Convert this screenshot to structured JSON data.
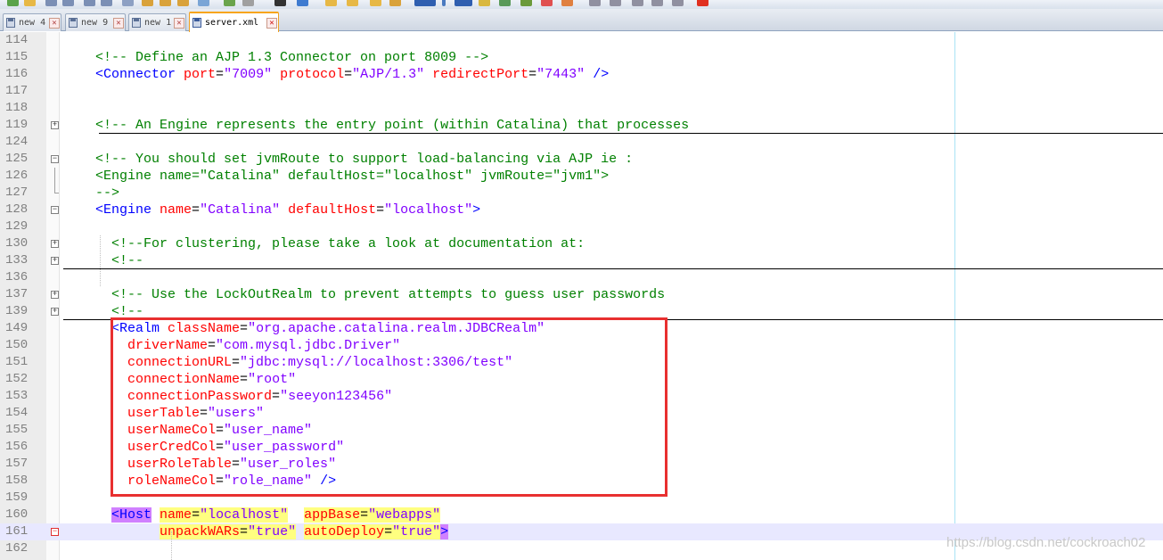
{
  "tabs": [
    {
      "label": "new 4",
      "active": false
    },
    {
      "label": "new 9",
      "active": false
    },
    {
      "label": "new 1",
      "active": false
    },
    {
      "label": "server.xml",
      "active": true
    }
  ],
  "tab_close_glyph": "✕",
  "editor": {
    "lines": [
      {
        "num": "114",
        "tokens": []
      },
      {
        "num": "115",
        "tokens": [
          {
            "c": "c",
            "t": "    <!-- Define an AJP 1.3 Connector on port 8009 -->"
          }
        ]
      },
      {
        "num": "116",
        "tokens": [
          {
            "c": "t",
            "t": "    <Connector "
          },
          {
            "c": "a",
            "t": "port"
          },
          {
            "c": "p",
            "t": "="
          },
          {
            "c": "v",
            "t": "\"7009\""
          },
          {
            "c": "a",
            "t": " protocol"
          },
          {
            "c": "p",
            "t": "="
          },
          {
            "c": "v",
            "t": "\"AJP/1.3\""
          },
          {
            "c": "a",
            "t": " redirectPort"
          },
          {
            "c": "p",
            "t": "="
          },
          {
            "c": "v",
            "t": "\"7443\""
          },
          {
            "c": "t",
            "t": " />"
          }
        ]
      },
      {
        "num": "117",
        "tokens": []
      },
      {
        "num": "118",
        "tokens": []
      },
      {
        "num": "119",
        "tokens": [
          {
            "c": "c",
            "t": "    <!-- An Engine represents the entry point (within Catalina) that processes"
          }
        ]
      },
      {
        "num": "124",
        "tokens": []
      },
      {
        "num": "125",
        "tokens": [
          {
            "c": "c",
            "t": "    <!-- You should set jvmRoute to support load-balancing via AJP ie :"
          }
        ]
      },
      {
        "num": "126",
        "tokens": [
          {
            "c": "c",
            "t": "    <Engine name=\"Catalina\" defaultHost=\"localhost\" jvmRoute=\"jvm1\">"
          }
        ]
      },
      {
        "num": "127",
        "tokens": [
          {
            "c": "c",
            "t": "    -->"
          }
        ]
      },
      {
        "num": "128",
        "tokens": [
          {
            "c": "t",
            "t": "    <Engine "
          },
          {
            "c": "a",
            "t": "name"
          },
          {
            "c": "p",
            "t": "="
          },
          {
            "c": "v",
            "t": "\"Catalina\""
          },
          {
            "c": "a",
            "t": " defaultHost"
          },
          {
            "c": "p",
            "t": "="
          },
          {
            "c": "v",
            "t": "\"localhost\""
          },
          {
            "c": "t",
            "t": ">"
          }
        ]
      },
      {
        "num": "129",
        "tokens": []
      },
      {
        "num": "130",
        "tokens": [
          {
            "c": "c",
            "t": "      <!--For clustering, please take a look at documentation at:"
          }
        ]
      },
      {
        "num": "133",
        "tokens": [
          {
            "c": "c",
            "t": "      <!--"
          }
        ]
      },
      {
        "num": "136",
        "tokens": []
      },
      {
        "num": "137",
        "tokens": [
          {
            "c": "c",
            "t": "      <!-- Use the LockOutRealm to prevent attempts to guess user passwords"
          }
        ]
      },
      {
        "num": "139",
        "tokens": [
          {
            "c": "c",
            "t": "      <!--"
          }
        ]
      },
      {
        "num": "149",
        "tokens": [
          {
            "c": "t",
            "t": "      <Realm "
          },
          {
            "c": "a",
            "t": "className"
          },
          {
            "c": "p",
            "t": "="
          },
          {
            "c": "v",
            "t": "\"org.apache.catalina.realm.JDBCRealm\""
          }
        ]
      },
      {
        "num": "150",
        "tokens": [
          {
            "c": "a",
            "t": "        driverName"
          },
          {
            "c": "p",
            "t": "="
          },
          {
            "c": "v",
            "t": "\"com.mysql.jdbc.Driver\""
          }
        ]
      },
      {
        "num": "151",
        "tokens": [
          {
            "c": "a",
            "t": "        connectionURL"
          },
          {
            "c": "p",
            "t": "="
          },
          {
            "c": "v",
            "t": "\"jdbc:mysql://localhost:3306/test\""
          }
        ]
      },
      {
        "num": "152",
        "tokens": [
          {
            "c": "a",
            "t": "        connectionName"
          },
          {
            "c": "p",
            "t": "="
          },
          {
            "c": "v",
            "t": "\"root\""
          }
        ]
      },
      {
        "num": "153",
        "tokens": [
          {
            "c": "a",
            "t": "        connectionPassword"
          },
          {
            "c": "p",
            "t": "="
          },
          {
            "c": "v",
            "t": "\"seeyon123456\""
          }
        ]
      },
      {
        "num": "154",
        "tokens": [
          {
            "c": "a",
            "t": "        userTable"
          },
          {
            "c": "p",
            "t": "="
          },
          {
            "c": "v",
            "t": "\"users\""
          }
        ]
      },
      {
        "num": "155",
        "tokens": [
          {
            "c": "a",
            "t": "        userNameCol"
          },
          {
            "c": "p",
            "t": "="
          },
          {
            "c": "v",
            "t": "\"user_name\""
          }
        ]
      },
      {
        "num": "156",
        "tokens": [
          {
            "c": "a",
            "t": "        userCredCol"
          },
          {
            "c": "p",
            "t": "="
          },
          {
            "c": "v",
            "t": "\"user_password\""
          }
        ]
      },
      {
        "num": "157",
        "tokens": [
          {
            "c": "a",
            "t": "        userRoleTable"
          },
          {
            "c": "p",
            "t": "="
          },
          {
            "c": "v",
            "t": "\"user_roles\""
          }
        ]
      },
      {
        "num": "158",
        "tokens": [
          {
            "c": "a",
            "t": "        roleNameCol"
          },
          {
            "c": "p",
            "t": "="
          },
          {
            "c": "v",
            "t": "\"role_name\""
          },
          {
            "c": "t",
            "t": " />"
          }
        ]
      },
      {
        "num": "159",
        "tokens": []
      },
      {
        "num": "160",
        "tokens": [
          {
            "c": "p",
            "t": "      "
          },
          {
            "c": "t hlm",
            "t": "<Host"
          },
          {
            "c": "p",
            "t": " "
          },
          {
            "c": "a hl",
            "t": "name"
          },
          {
            "c": "p hl",
            "t": "="
          },
          {
            "c": "v hl",
            "t": "\"localhost\""
          },
          {
            "c": "p",
            "t": "  "
          },
          {
            "c": "a hl",
            "t": "appBase"
          },
          {
            "c": "p hl",
            "t": "="
          },
          {
            "c": "v hl",
            "t": "\"webapps\""
          }
        ]
      },
      {
        "num": "161",
        "tokens": [
          {
            "c": "p",
            "t": "            "
          },
          {
            "c": "a hl",
            "t": "unpackWARs"
          },
          {
            "c": "p hl",
            "t": "="
          },
          {
            "c": "v hl",
            "t": "\"true\""
          },
          {
            "c": "p",
            "t": " "
          },
          {
            "c": "a hl",
            "t": "autoDeploy"
          },
          {
            "c": "p hl",
            "t": "="
          },
          {
            "c": "v hl",
            "t": "\"true\""
          },
          {
            "c": "t hlm",
            "t": ">"
          }
        ]
      },
      {
        "num": "162",
        "tokens": []
      }
    ]
  },
  "watermark": "https://blog.csdn.net/cockroach02",
  "colors": {
    "comment": "#008000",
    "tag": "#0000ff",
    "attribute": "#ff0000",
    "value": "#8000ff",
    "highlight": "#ffff80",
    "tag_match": "#d080ff",
    "annotation_box": "#e83030",
    "current_line": "#e8e8ff"
  }
}
